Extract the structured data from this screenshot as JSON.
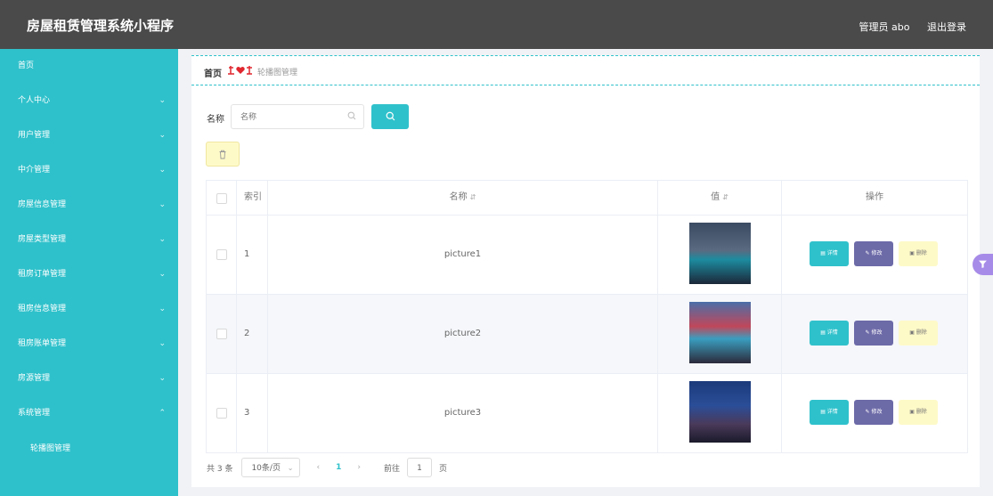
{
  "app": {
    "title": "房屋租赁管理系统小程序"
  },
  "header": {
    "user": "管理员 abo",
    "logout": "退出登录"
  },
  "sidebar": {
    "items": [
      {
        "label": "首页"
      },
      {
        "label": "个人中心"
      },
      {
        "label": "用户管理"
      },
      {
        "label": "中介管理"
      },
      {
        "label": "房屋信息管理"
      },
      {
        "label": "房屋类型管理"
      },
      {
        "label": "租房订单管理"
      },
      {
        "label": "租房信息管理"
      },
      {
        "label": "租房账单管理"
      },
      {
        "label": "房源管理"
      },
      {
        "label": "系统管理"
      }
    ],
    "sub_items": [
      {
        "label": "轮播图管理"
      }
    ]
  },
  "breadcrumb": {
    "home": "首页",
    "current": "轮播图管理"
  },
  "search": {
    "label": "名称",
    "placeholder": "名称"
  },
  "table": {
    "headers": {
      "index": "索引",
      "name": "名称",
      "value": "值",
      "ops": "操作"
    },
    "rows": [
      {
        "index": "1",
        "name": "picture1"
      },
      {
        "index": "2",
        "name": "picture2"
      },
      {
        "index": "3",
        "name": "picture3"
      }
    ],
    "buttons": {
      "detail": "详情",
      "edit": "修改",
      "delete": "删除"
    }
  },
  "pagination": {
    "total": "共 3 条",
    "page_size": "10条/页",
    "current": "1",
    "goto_label": "前往",
    "goto_value": "1",
    "goto_unit": "页"
  },
  "colors": {
    "accent": "#2fc1cb",
    "header": "#4a4a4a",
    "edit": "#6d6aa8",
    "delete": "#fefac8"
  }
}
